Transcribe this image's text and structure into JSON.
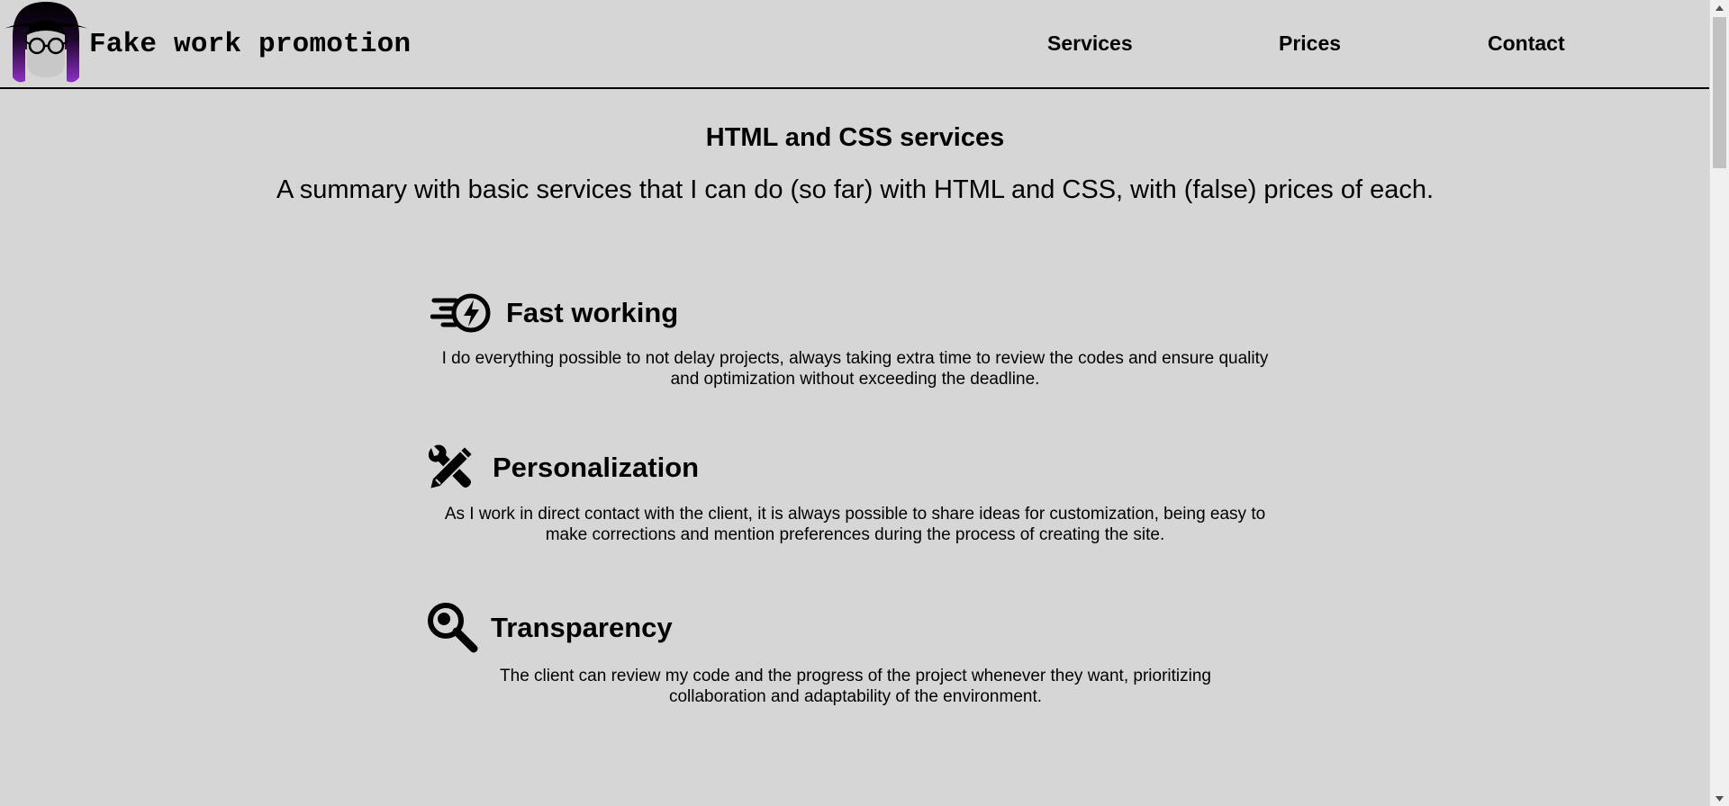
{
  "header": {
    "brand": "Fake work promotion",
    "nav": [
      {
        "label": "Services"
      },
      {
        "label": "Prices"
      },
      {
        "label": "Contact"
      }
    ]
  },
  "intro": {
    "title": "HTML and CSS services",
    "text": "A summary with basic services that I can do (so far) with HTML and CSS, with (false) prices of each."
  },
  "features": [
    {
      "icon": "fast-bolt-icon",
      "title": "Fast working",
      "text": "I do everything possible to not delay projects, always taking extra time to review the codes and ensure quality and optimization without exceeding the deadline."
    },
    {
      "icon": "pencil-wrench-icon",
      "title": "Personalization",
      "text": "As I work in direct contact with the client, it is always possible to share ideas for customization, being easy to make corrections and mention preferences during the process of creating the site."
    },
    {
      "icon": "magnifier-icon",
      "title": "Transparency",
      "text": "The client can review my code and the progress of the project whenever they want, prioritizing collaboration and adaptability of the environment."
    }
  ],
  "colors": {
    "background": "#d6d6d6",
    "text": "#000000",
    "logo_hair_accent": "#8e2fc4"
  }
}
